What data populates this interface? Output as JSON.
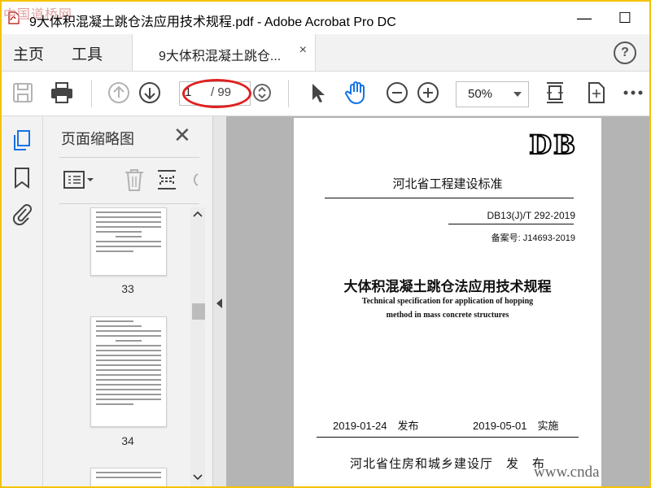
{
  "watermark": {
    "top_left": "中国道桥网",
    "bottom_right": "www.cnda"
  },
  "window": {
    "title": "9大体积混凝土跳仓法应用技术规程.pdf - Adobe Acrobat Pro DC",
    "min_label": "—",
    "max_label": "☐"
  },
  "tabs": {
    "home": "主页",
    "tools": "工具",
    "document": "9大体积混凝土跳仓...",
    "close_glyph": "×",
    "help_glyph": "?"
  },
  "toolbar": {
    "current_page": "1",
    "total_pages": "/ 99",
    "zoom": "50%"
  },
  "thumbnail_panel": {
    "title": "页面缩略图",
    "close_glyph": "✕",
    "pages": [
      {
        "number": "33"
      },
      {
        "number": "34"
      }
    ]
  },
  "document_page": {
    "logo": "DB",
    "category": "河北省工程建设标准",
    "standard_no": "DB13(J)/T 292-2019",
    "record_no": "备案号: J14693-2019",
    "title_cn": "大体积混凝土跳仓法应用技术规程",
    "title_en_1": "Technical specification for application of hopping",
    "title_en_2": "method in mass concrete structures",
    "release_date": "2019-01-24　发布",
    "effective_date": "2019-05-01　实施",
    "issuer": "河北省住房和城乡建设厅　发　布"
  },
  "colors": {
    "accent": "#1473e6",
    "annotation": "#e02020",
    "frame": "#f4c300"
  }
}
